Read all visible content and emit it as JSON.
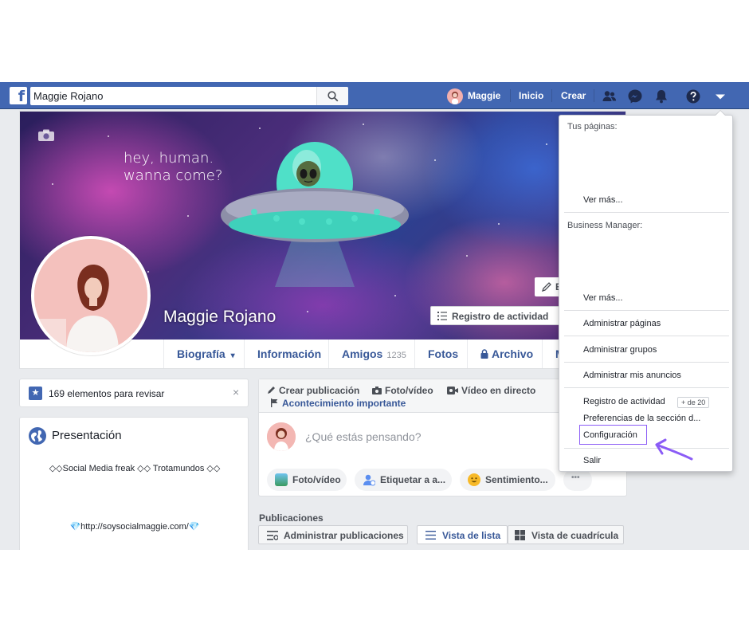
{
  "topbar": {
    "search_value": "Maggie Rojano",
    "user_name": "Maggie",
    "home_label": "Inicio",
    "create_label": "Crear",
    "icons": [
      "facebook-logo-icon",
      "search-icon",
      "friend-requests-icon",
      "messenger-icon",
      "notifications-icon",
      "help-icon",
      "account-menu-caret-icon"
    ]
  },
  "cover": {
    "tagline_line1": "hey, human.",
    "tagline_line2": "wanna come?",
    "name": "Maggie Rojano",
    "edit_label": "E",
    "activity_label": "Registro de actividad",
    "activity_plus": "+"
  },
  "tabs": {
    "biography": "Biografía",
    "biography_caret": "▾",
    "info": "Información",
    "friends": "Amigos",
    "friends_count": "1235",
    "photos": "Fotos",
    "archive": "Archivo",
    "more": "M"
  },
  "review": {
    "text": "169 elementos para revisar",
    "close": "×"
  },
  "presentation": {
    "title": "Presentación",
    "bio": "◇◇Social Media freak ◇◇ Trotamundos ◇◇",
    "link": "💎http://soysocialmaggie.com/💎"
  },
  "composer": {
    "create_post": "Crear publicación",
    "photo_video": "Foto/vídeo",
    "live_video": "Vídeo en directo",
    "life_event": "Acontecimiento importante",
    "prompt": "¿Qué estás pensando?",
    "pill_photo": "Foto/vídeo",
    "pill_tag": "Etiquetar a a...",
    "pill_feeling": "Sentimiento...",
    "pill_more": "•••"
  },
  "publications": {
    "title": "Publicaciones",
    "manage": "Administrar publicaciones",
    "list_view": "Vista de lista",
    "grid_view": "Vista de cuadrícula"
  },
  "dropdown": {
    "your_pages": "Tus páginas:",
    "see_more_1": "Ver más...",
    "business_manager": "Business Manager:",
    "see_more_2": "Ver más...",
    "manage_pages": "Administrar páginas",
    "manage_groups": "Administrar grupos",
    "manage_ads": "Administrar mis anuncios",
    "activity_log": "Registro de actividad",
    "activity_count": "+ de 20",
    "news_feed_prefs": "Preferencias de la sección d...",
    "settings": "Configuración",
    "logout": "Salir"
  },
  "colors": {
    "topbar": "#4267b2",
    "link": "#385898",
    "highlight_box": "#8b5cf6",
    "arrow": "#8b5cf6"
  }
}
